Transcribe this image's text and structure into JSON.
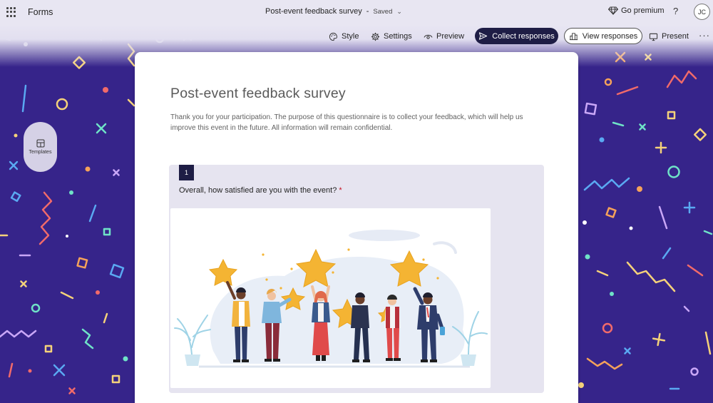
{
  "app": {
    "name": "Forms"
  },
  "document": {
    "title": "Post-event feedback survey",
    "separator": "-",
    "status": "Saved"
  },
  "header": {
    "premium_label": "Go premium",
    "help_label": "?",
    "avatar_initials": "JC"
  },
  "toolbar": {
    "style_label": "Style",
    "settings_label": "Settings",
    "preview_label": "Preview",
    "collect_label": "Collect responses",
    "view_label": "View responses",
    "present_label": "Present",
    "more_label": "···"
  },
  "sidebar": {
    "templates_label": "Templates"
  },
  "form": {
    "title": "Post-event feedback survey",
    "description": "Thank you for your participation. The purpose of this questionnaire is to collect your feedback, which will help us improve this event in the future. All information will remain confidential.",
    "questions": [
      {
        "number": "1",
        "text": "Overall, how satisfied are you with the event?",
        "required_mark": "*"
      }
    ]
  },
  "colors": {
    "accent_dark": "#1e1d45",
    "background_purple": "#36248a",
    "required": "#c50f1f",
    "star": "#f4b433"
  }
}
